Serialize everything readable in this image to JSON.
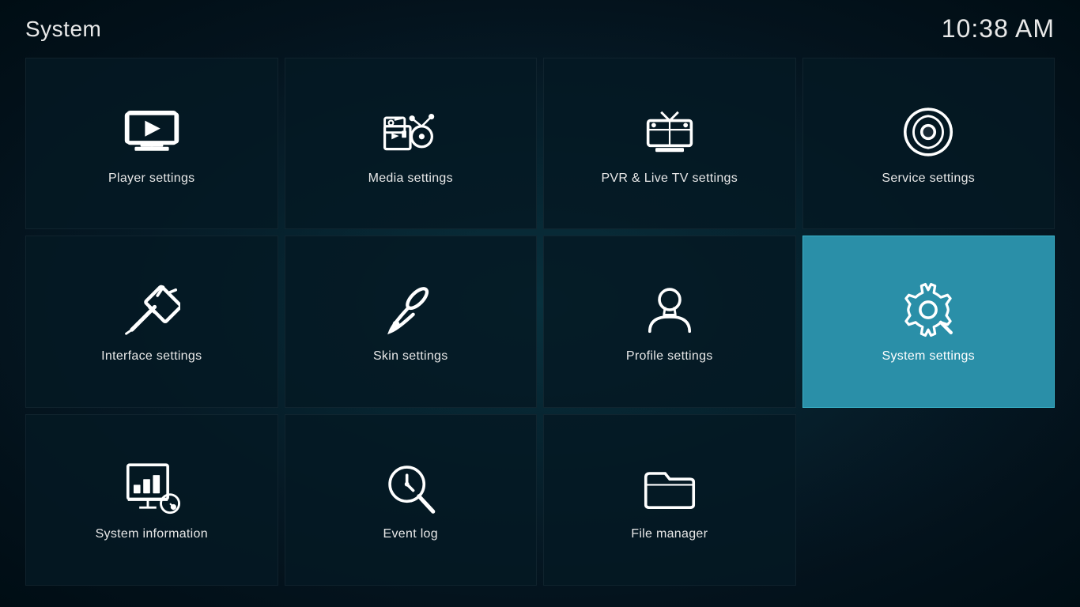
{
  "header": {
    "title": "System",
    "clock": "10:38 AM"
  },
  "tiles": [
    {
      "id": "player-settings",
      "label": "Player settings",
      "icon": "player",
      "active": false
    },
    {
      "id": "media-settings",
      "label": "Media settings",
      "icon": "media",
      "active": false
    },
    {
      "id": "pvr-settings",
      "label": "PVR & Live TV settings",
      "icon": "pvr",
      "active": false
    },
    {
      "id": "service-settings",
      "label": "Service settings",
      "icon": "service",
      "active": false
    },
    {
      "id": "interface-settings",
      "label": "Interface settings",
      "icon": "interface",
      "active": false
    },
    {
      "id": "skin-settings",
      "label": "Skin settings",
      "icon": "skin",
      "active": false
    },
    {
      "id": "profile-settings",
      "label": "Profile settings",
      "icon": "profile",
      "active": false
    },
    {
      "id": "system-settings",
      "label": "System settings",
      "icon": "system",
      "active": true
    },
    {
      "id": "system-information",
      "label": "System information",
      "icon": "sysinfo",
      "active": false
    },
    {
      "id": "event-log",
      "label": "Event log",
      "icon": "eventlog",
      "active": false
    },
    {
      "id": "file-manager",
      "label": "File manager",
      "icon": "filemanager",
      "active": false
    },
    {
      "id": "empty",
      "label": "",
      "icon": "none",
      "active": false
    }
  ]
}
